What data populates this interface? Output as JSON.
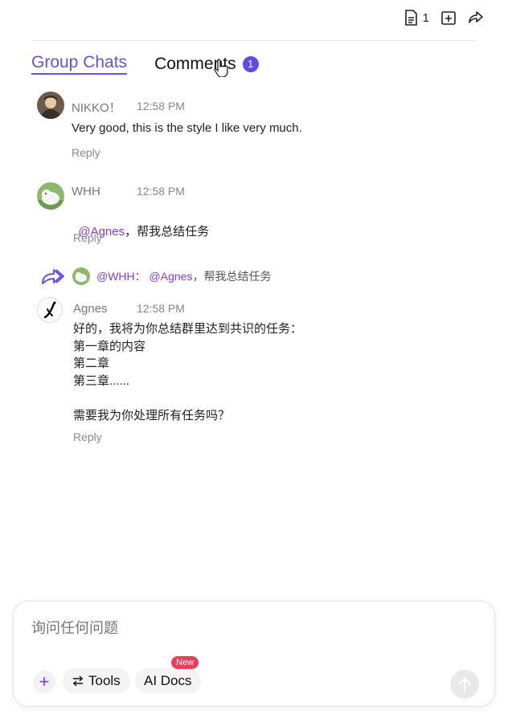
{
  "toolbar": {
    "doc_count": "1"
  },
  "tabs": [
    {
      "label": "Group Chats"
    },
    {
      "label": "Comments",
      "badge": "1"
    }
  ],
  "messages": [
    {
      "name": "NIKKO！",
      "time": "12:58 PM",
      "text": "Very good, this is the style I like very much.",
      "reply": "Reply"
    },
    {
      "name": "WHH",
      "time": "12:58 PM",
      "mention": "@Agnes",
      "text": "，帮我总结任务",
      "reply": "Reply"
    },
    {
      "name": "Agnes",
      "time": "12:58 PM",
      "text": "好的，我将为你总结群里达到共识的任务：\n第一章的内容\n第二章\n第三章......\n\n需要我为你处理所有任务吗？",
      "reply": "Reply"
    }
  ],
  "quote": {
    "author": "@WHH：",
    "mention": "@Agnes",
    "text": "，帮我总结任务"
  },
  "composer": {
    "placeholder": "询问任何问题",
    "tools_label": "Tools",
    "aidocs_label": "AI Docs",
    "new_badge": "New"
  }
}
